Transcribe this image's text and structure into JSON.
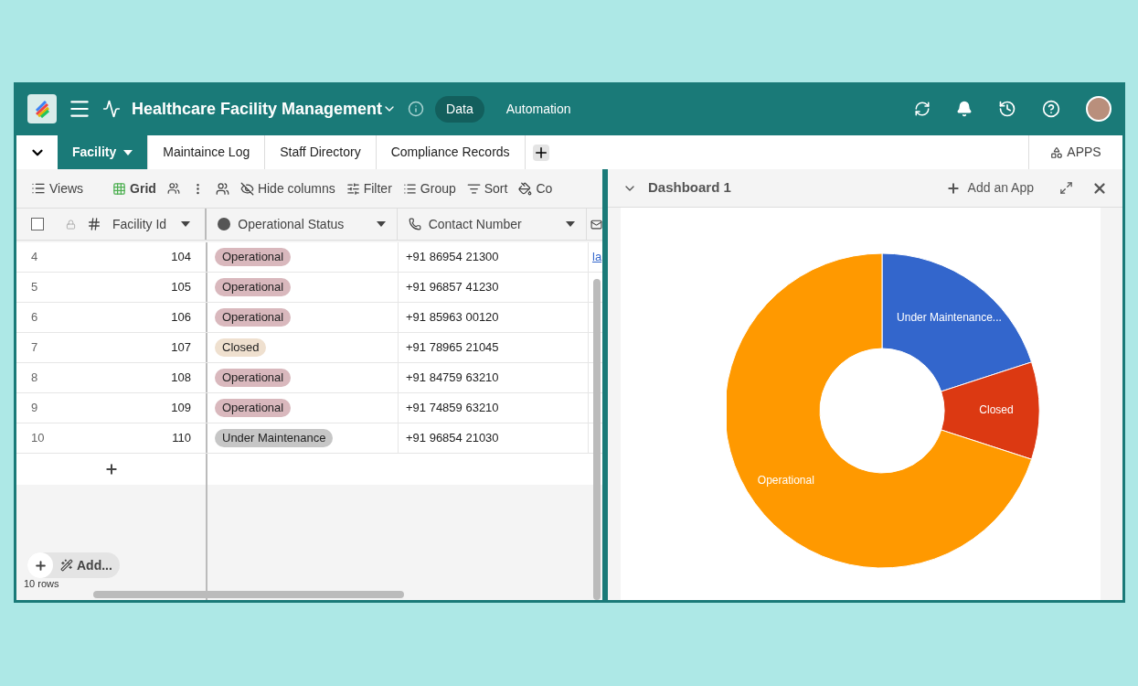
{
  "header": {
    "title": "Healthcare Facility Management",
    "nav": [
      {
        "label": "Data",
        "selected": true
      },
      {
        "label": "Automation",
        "selected": false
      }
    ]
  },
  "tabs": [
    {
      "label": "Facility",
      "selected": true
    },
    {
      "label": "Maintaince Log",
      "selected": false
    },
    {
      "label": "Staff Directory",
      "selected": false
    },
    {
      "label": "Compliance Records",
      "selected": false
    }
  ],
  "apps_button": "APPS",
  "toolbar": {
    "views": "Views",
    "grid": "Grid",
    "hide_columns": "Hide columns",
    "filter": "Filter",
    "group": "Group",
    "sort": "Sort",
    "cut_item": "Co"
  },
  "table": {
    "select_all": {
      "checked": false
    },
    "columns": [
      "Facility Id",
      "Operational Status",
      "Contact Number"
    ],
    "rows": [
      {
        "num": "4",
        "id": "104",
        "status": "Operational",
        "color": "#d9b8bd",
        "contact": "+91 86954 21300",
        "column_4": "la"
      },
      {
        "num": "5",
        "id": "105",
        "status": "Operational",
        "color": "#d9b8bd",
        "contact": "+91 96857 41230"
      },
      {
        "num": "6",
        "id": "106",
        "status": "Operational",
        "color": "#d9b8bd",
        "contact": "+91 85963 00120"
      },
      {
        "num": "7",
        "id": "107",
        "status": "Closed",
        "color": "#efe0cf",
        "contact": "+91 78965 21045"
      },
      {
        "num": "8",
        "id": "108",
        "status": "Operational",
        "color": "#d9b8bd",
        "contact": "+91 84759 63210"
      },
      {
        "num": "9",
        "id": "109",
        "status": "Operational",
        "color": "#d9b8bd",
        "contact": "+91 74859 63210"
      },
      {
        "num": "10",
        "id": "110",
        "status": "Under Maintenance",
        "color": "#c6c6c6",
        "contact": "+91 96854 21030"
      }
    ],
    "add_button": "Add...",
    "row_count": "10 rows"
  },
  "dashboard": {
    "title": "Dashboard 1",
    "add_app": "Add an App",
    "chart_data": {
      "type": "donut",
      "categories": [
        "Under Maintenance...",
        "Closed",
        "Operational"
      ],
      "series": [
        {
          "colors": [
            "#3366cc",
            "#dc3912",
            "#ff9900"
          ],
          "values": [
            20,
            10,
            70
          ]
        }
      ]
    }
  }
}
